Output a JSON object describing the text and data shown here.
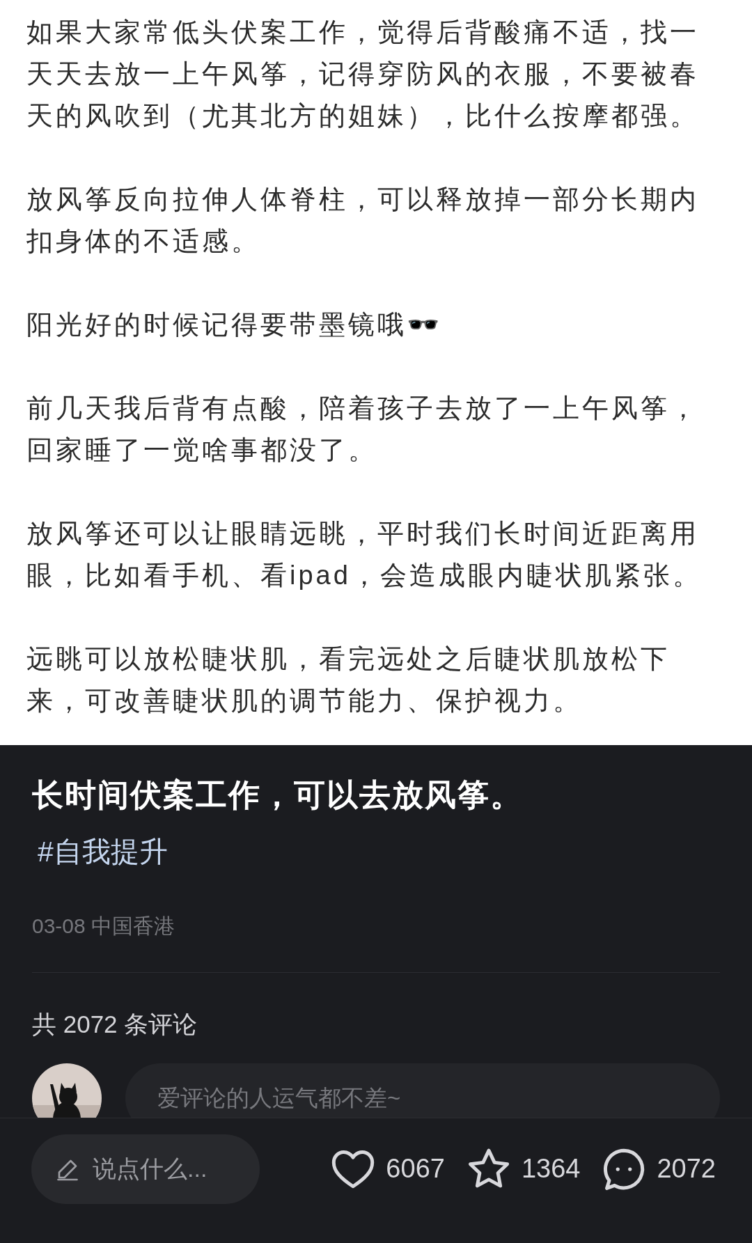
{
  "post_image": {
    "paragraphs": [
      "如果大家常低头伏案工作，觉得后背酸痛不适，找一天天去放一上午风筝，记得穿防风的衣服，不要被春天的风吹到（尤其北方的姐妹），比什么按摩都强。",
      "放风筝反向拉伸人体脊柱，可以释放掉一部分长期内扣身体的不适感。",
      "阳光好的时候记得要带墨镜哦🕶️",
      "前几天我后背有点酸，陪着孩子去放了一上午风筝，回家睡了一觉啥事都没了。",
      "放风筝还可以让眼睛远眺，平时我们长时间近距离用眼，比如看手机、看ipad，会造成眼内睫状肌紧张。",
      "远眺可以放松睫状肌，看完远处之后睫状肌放松下来，可改善睫状肌的调节能力、保护视力。"
    ]
  },
  "title": "长时间伏案工作，可以去放风筝。",
  "tags": [
    "#自我提升"
  ],
  "meta": "03-08 中国香港",
  "comments_count": "共 2072 条评论",
  "comment_input": {
    "placeholder": "爱评论的人运气都不差~"
  },
  "bottom_bar": {
    "write_button": "说点什么...",
    "actions": [
      {
        "kind": "like",
        "count": "6067"
      },
      {
        "kind": "collect",
        "count": "1364"
      },
      {
        "kind": "comment",
        "count": "2072"
      }
    ]
  }
}
